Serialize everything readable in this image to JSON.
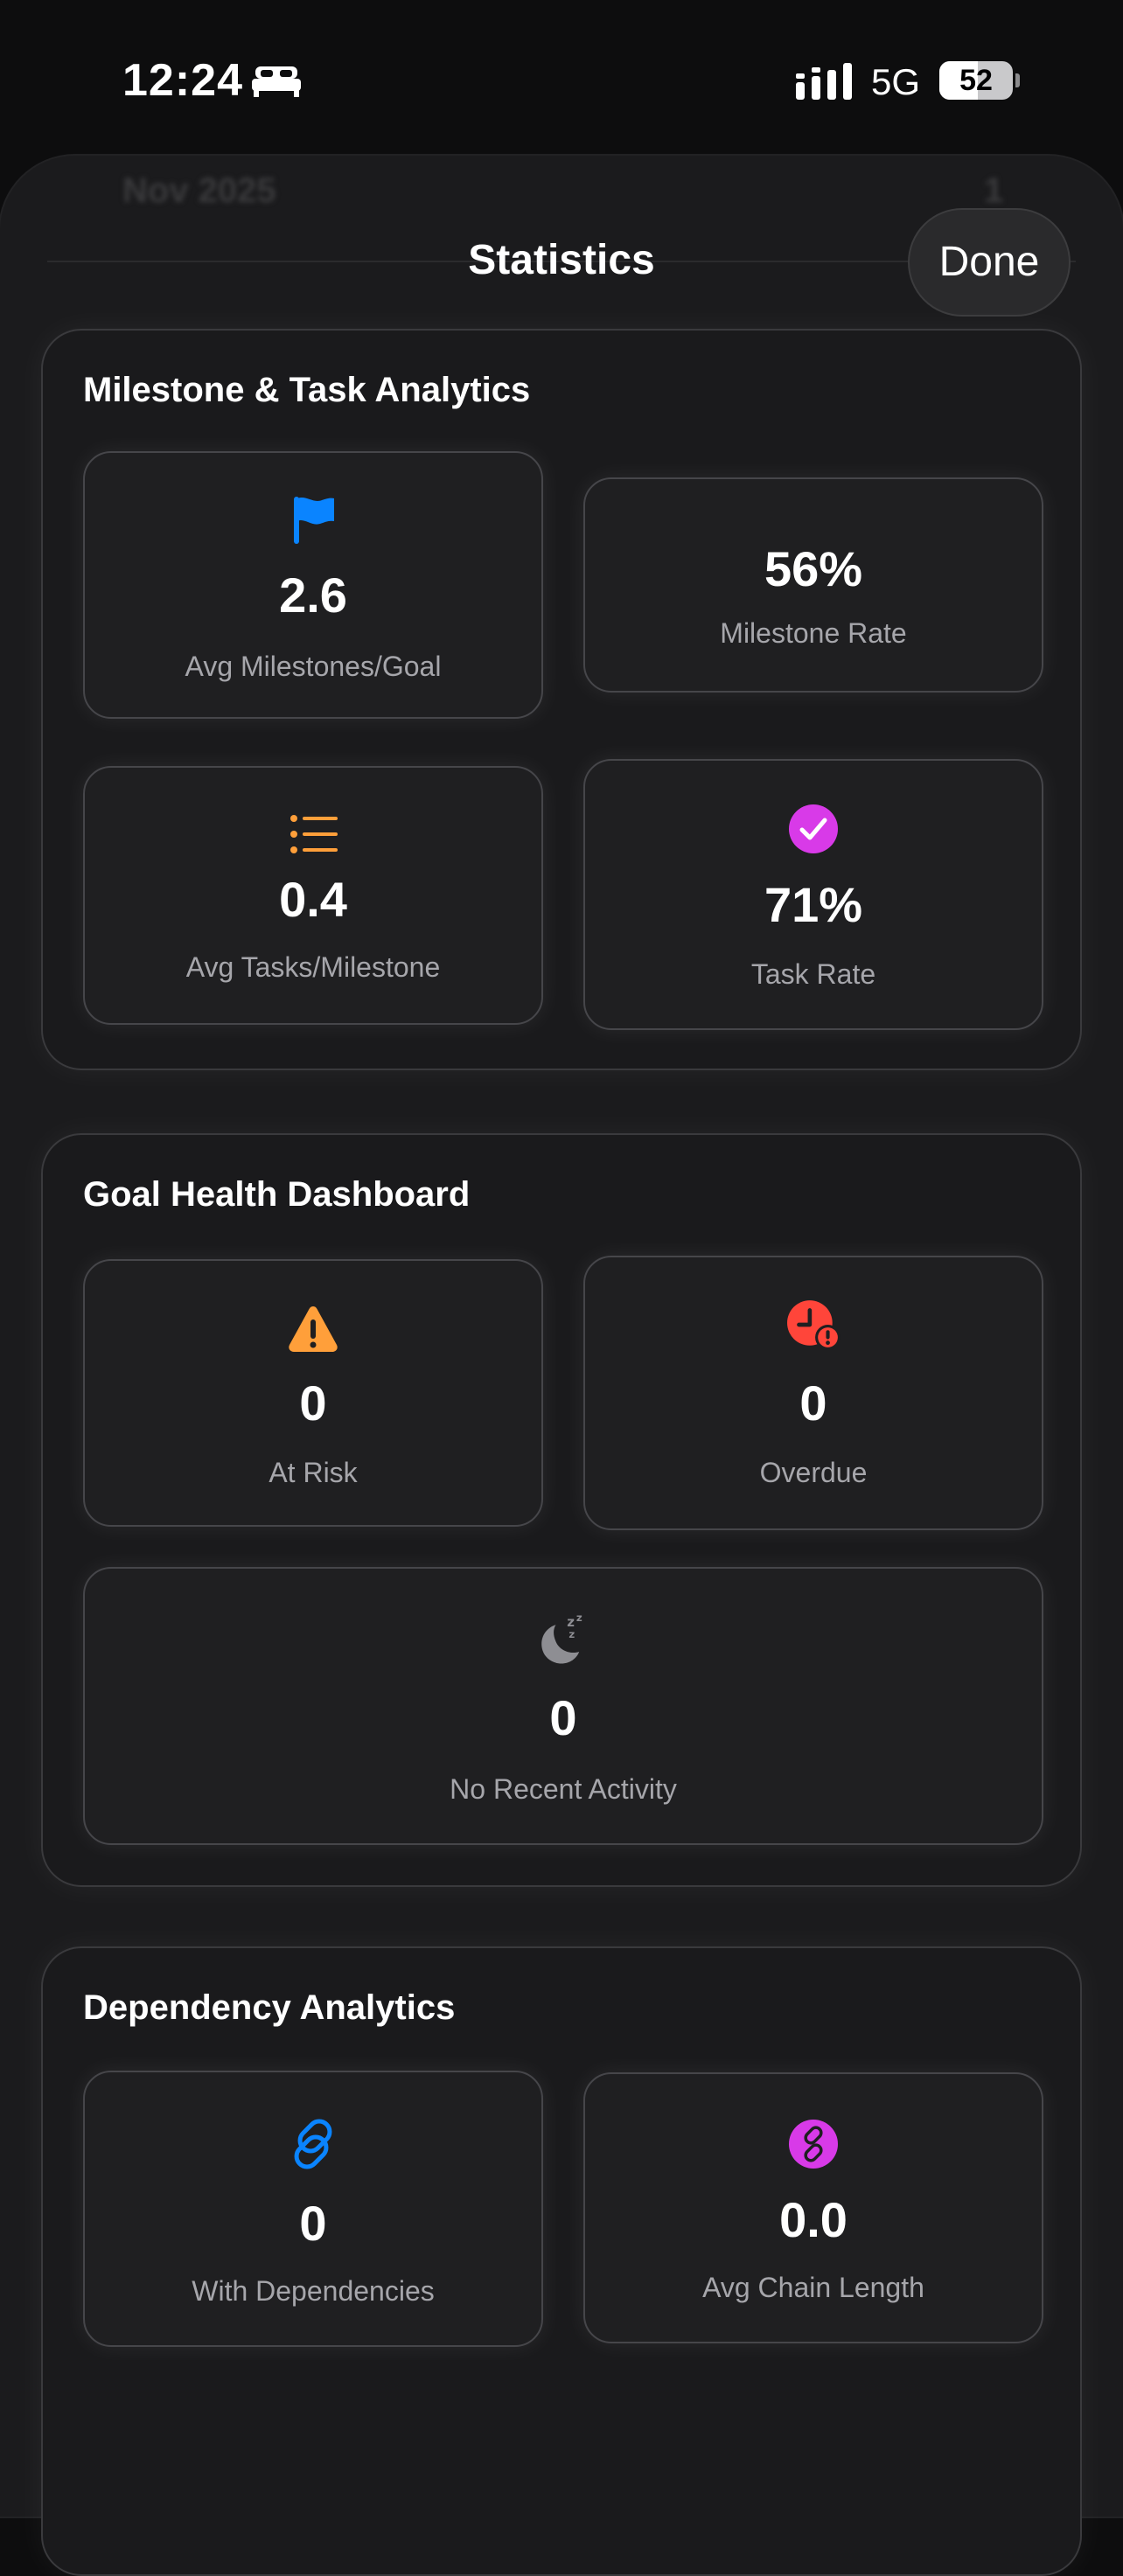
{
  "status_bar": {
    "time": "12:24",
    "focus_icon": "bed-icon",
    "network": "5G",
    "battery": "52",
    "battery_level": 0.52
  },
  "background_peek": {
    "text": "Nov 2025",
    "count": "1"
  },
  "header": {
    "title": "Statistics",
    "done_label": "Done"
  },
  "sections": {
    "milestone": {
      "title": "Milestone & Task Analytics",
      "cards": [
        {
          "icon": "flag-icon",
          "color": "#0a84ff",
          "value": "2.6",
          "label": "Avg Milestones/Goal"
        },
        {
          "icon": null,
          "value": "56%",
          "label": "Milestone Rate"
        },
        {
          "icon": "list-bullet-icon",
          "color": "#ff9f3a",
          "value": "0.4",
          "label": "Avg Tasks/Milestone"
        },
        {
          "icon": "checkmark-circle-icon",
          "color": "#d83ae8",
          "value": "71%",
          "label": "Task Rate"
        }
      ]
    },
    "health": {
      "title": "Goal Health Dashboard",
      "cards": [
        {
          "icon": "warning-triangle-icon",
          "color": "#ff9f3a",
          "value": "0",
          "label": "At Risk"
        },
        {
          "icon": "clock-alert-icon",
          "color": "#ff453a",
          "value": "0",
          "label": "Overdue"
        },
        {
          "icon": "moon-zzz-icon",
          "color": "#8e8e93",
          "value": "0",
          "label": "No Recent Activity"
        }
      ]
    },
    "dependency": {
      "title": "Dependency Analytics",
      "cards": [
        {
          "icon": "link-icon",
          "color": "#0a84ff",
          "value": "0",
          "label": "With Dependencies"
        },
        {
          "icon": "link-circle-icon",
          "color": "#d83ae8",
          "value": "0.0",
          "label": "Avg Chain Length"
        }
      ]
    }
  }
}
